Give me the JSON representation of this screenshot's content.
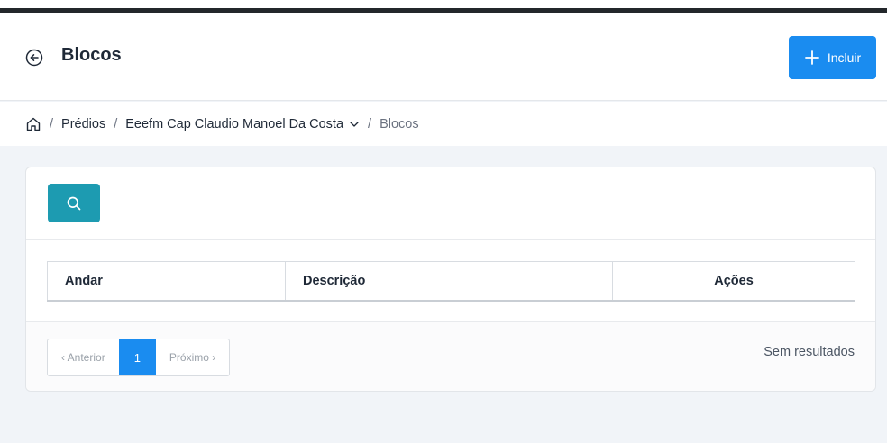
{
  "header": {
    "title": "Blocos",
    "add_label": "Incluir"
  },
  "breadcrumb": {
    "separator": "/",
    "items": [
      "Prédios",
      "Eeefm Cap Claudio Manoel Da Costa",
      "Blocos"
    ]
  },
  "table": {
    "columns": [
      "Andar",
      "Descrição",
      "Ações"
    ]
  },
  "pagination": {
    "previous": "‹ Anterior",
    "current": "1",
    "next": "Próximo ›"
  },
  "results_text": "Sem resultados",
  "colors": {
    "primary": "#1a8cf0",
    "search": "#1d9bb1",
    "top_bar": "#23272b"
  }
}
